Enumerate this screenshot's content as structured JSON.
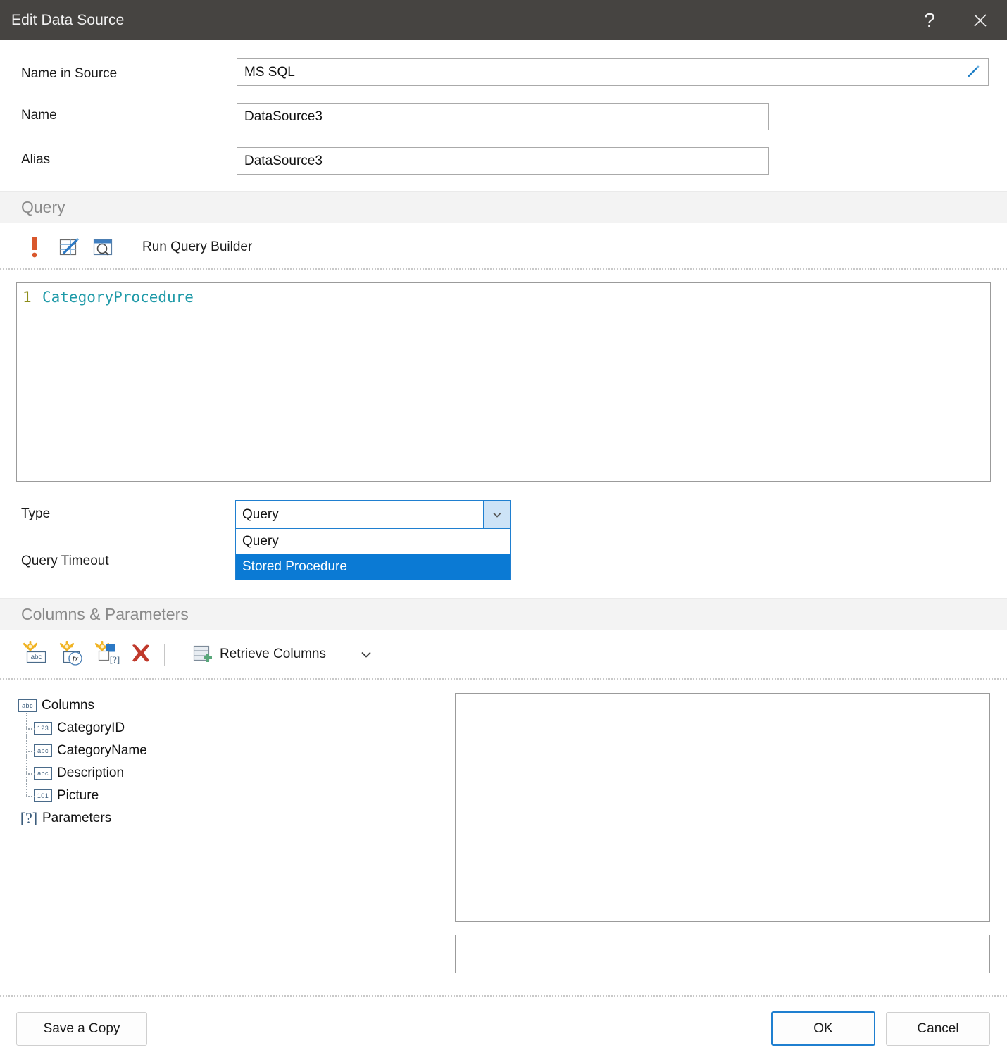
{
  "window": {
    "title": "Edit Data Source",
    "help_icon": "question-mark-icon",
    "help_glyph": "?",
    "close_icon": "close-icon"
  },
  "fields": {
    "name_in_source": {
      "label": "Name in Source",
      "value": "MS SQL",
      "edit_icon": "pencil-icon"
    },
    "name": {
      "label": "Name",
      "value": "DataSource3"
    },
    "alias": {
      "label": "Alias",
      "value": "DataSource3"
    }
  },
  "query_section": {
    "title": "Query",
    "toolbar": {
      "validate_icon": "exclamation-icon",
      "edit_query_icon": "edit-query-icon",
      "preview_icon": "preview-query-icon",
      "run_query_builder_label": "Run Query Builder"
    },
    "editor": {
      "line_number": "1",
      "code": "CategoryProcedure"
    },
    "type": {
      "label": "Type",
      "value": "Query",
      "options": [
        "Query",
        "Stored Procedure"
      ],
      "highlighted_option": "Stored Procedure",
      "arrow_icon": "chevron-down-icon"
    },
    "query_timeout": {
      "label": "Query Timeout"
    }
  },
  "columns_section": {
    "title": "Columns & Parameters",
    "toolbar": {
      "new_column_icon": "new-data-column-icon",
      "new_expression_column_icon": "new-expression-column-icon",
      "new_parameter_icon": "new-parameter-icon",
      "delete_icon": "delete-red-x-icon",
      "retrieve_columns_icon": "retrieve-columns-icon",
      "retrieve_columns_label": "Retrieve Columns",
      "retrieve_columns_dropdown_icon": "chevron-down-icon"
    },
    "tree": [
      {
        "label": "Columns",
        "icon": "abc-type-icon",
        "icon_text": "abc",
        "level": 0
      },
      {
        "label": "CategoryID",
        "icon": "number-type-icon",
        "icon_text": "123",
        "level": 1
      },
      {
        "label": "CategoryName",
        "icon": "abc-type-icon",
        "icon_text": "abc",
        "level": 1
      },
      {
        "label": "Description",
        "icon": "abc-type-icon",
        "icon_text": "abc",
        "level": 1
      },
      {
        "label": "Picture",
        "icon": "binary-type-icon",
        "icon_text": "101",
        "level": 1
      },
      {
        "label": "Parameters",
        "icon": "parameter-icon",
        "icon_text": "[?]",
        "level": 0
      }
    ]
  },
  "footer": {
    "save_copy_label": "Save a Copy",
    "ok_label": "OK",
    "cancel_label": "Cancel"
  },
  "colors": {
    "titlebar_bg": "#464441",
    "accent_blue": "#0b7ad4",
    "band_bg": "#f3f3f3",
    "band_text": "#8a8a8a",
    "code_text": "#1f9aa8",
    "gutter_text": "#8d8d1a",
    "delete_red": "#c0392b",
    "warning_orange": "#d9572c"
  }
}
